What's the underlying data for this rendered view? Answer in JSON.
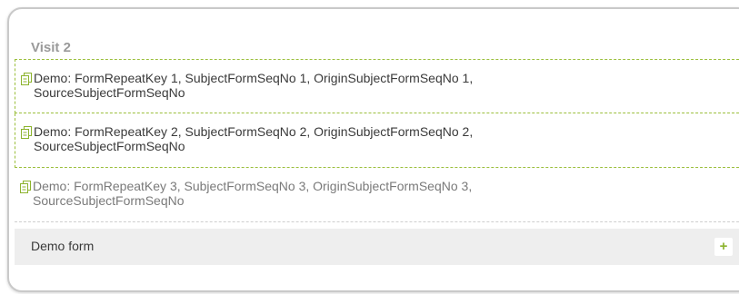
{
  "visit": {
    "title": "Visit 2"
  },
  "forms": [
    {
      "line1": "Demo: FormRepeatKey 1, SubjectFormSeqNo 1, OriginSubjectFormSeqNo 1,",
      "line2": "SourceSubjectFormSeqNo",
      "icon": "form-copy-icon",
      "state": "selected"
    },
    {
      "line1": "Demo: FormRepeatKey 2, SubjectFormSeqNo 2, OriginSubjectFormSeqNo 2,",
      "line2": "SourceSubjectFormSeqNo",
      "icon": "form-copy-icon",
      "state": "selected"
    },
    {
      "line1": "Demo: FormRepeatKey 3, SubjectFormSeqNo 3, OriginSubjectFormSeqNo 3,",
      "line2": "SourceSubjectFormSeqNo",
      "icon": "form-copy-icon",
      "state": "normal"
    }
  ],
  "add_form": {
    "label": "Demo form",
    "button_label": "+",
    "icon": "plus-icon"
  },
  "colors": {
    "accent": "#8cb32d",
    "selection_border": "#9bbf3c",
    "title_gray": "#9a9a9a",
    "bar_background": "#eeeeee"
  }
}
